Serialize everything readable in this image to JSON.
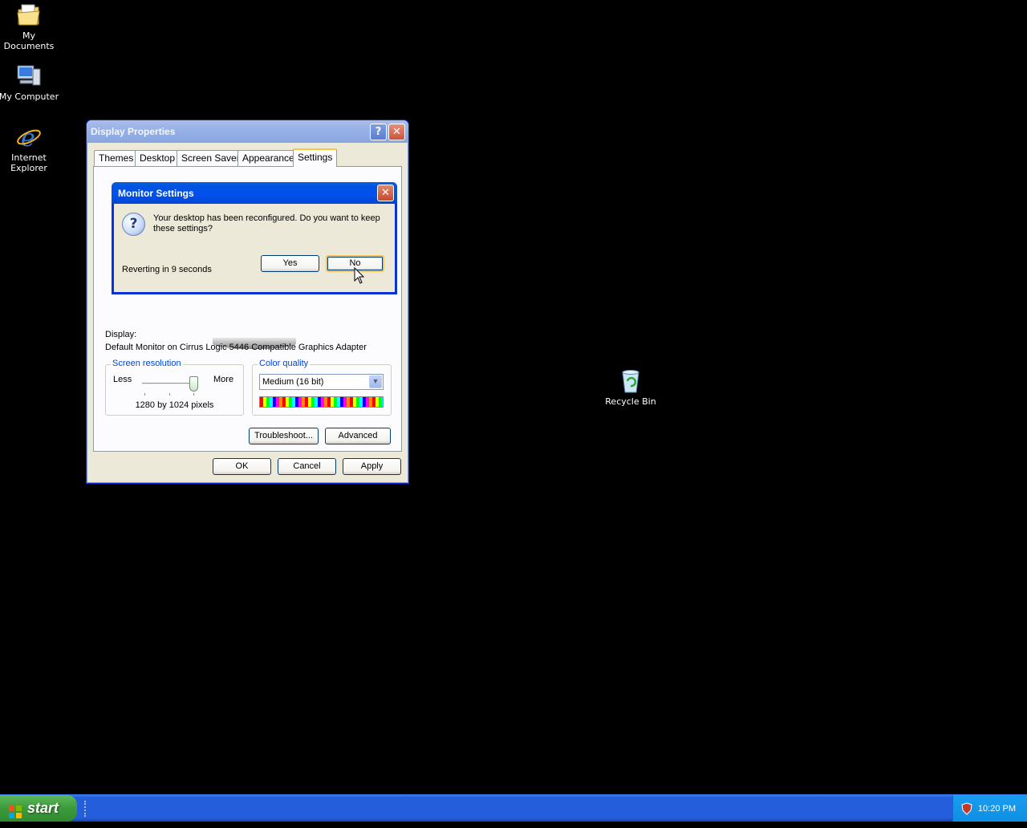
{
  "desktop": {
    "icons": [
      {
        "label": "My Documents"
      },
      {
        "label": "My Computer"
      },
      {
        "label": "Internet Explorer"
      },
      {
        "label": "Recycle Bin"
      }
    ]
  },
  "display_properties": {
    "title": "Display Properties",
    "help_glyph": "?",
    "close_glyph": "✕",
    "tabs": [
      "Themes",
      "Desktop",
      "Screen Saver",
      "Appearance",
      "Settings"
    ],
    "active_tab": "Settings",
    "display_label": "Display:",
    "display_value": "Default Monitor on Cirrus Logic 5446 Compatible Graphics Adapter",
    "screen_resolution": {
      "title": "Screen resolution",
      "less_label": "Less",
      "more_label": "More",
      "value": "1280 by 1024 pixels"
    },
    "color_quality": {
      "title": "Color quality",
      "selected": "Medium (16 bit)"
    },
    "buttons": {
      "troubleshoot": "Troubleshoot...",
      "advanced": "Advanced",
      "ok": "OK",
      "cancel": "Cancel",
      "apply": "Apply"
    }
  },
  "monitor_settings": {
    "title": "Monitor Settings",
    "close_glyph": "✕",
    "icon_glyph": "?",
    "message": "Your desktop has been reconfigured.  Do you want to keep these settings?",
    "reverting": "Reverting in 9 seconds",
    "yes_label": "Yes",
    "no_label": "No"
  },
  "taskbar": {
    "start_label": "start",
    "clock": "10:20 PM"
  },
  "colors": {
    "accent": "#0046d5",
    "desktop_bg": "#000000"
  }
}
